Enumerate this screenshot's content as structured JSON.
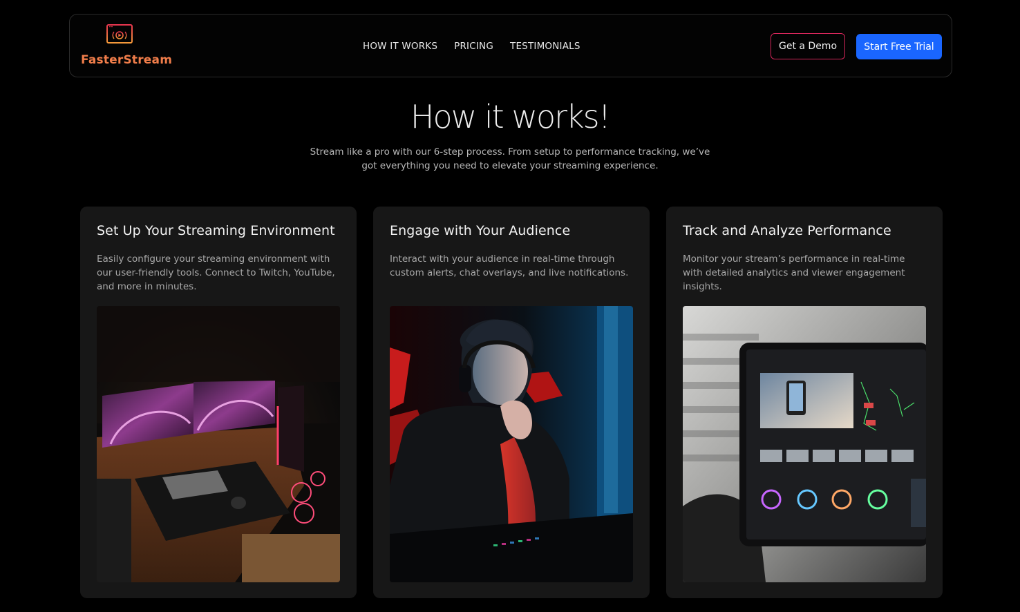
{
  "brand": {
    "name": "FasterStream",
    "logo_icon": "monitor-stream-icon",
    "accent": "#f07d4a"
  },
  "nav": {
    "links": [
      "HOW IT WORKS",
      "PRICING",
      "TESTIMONIALS"
    ],
    "demo_label": "Get a Demo",
    "trial_label": "Start Free Trial",
    "demo_border_color": "#d6265a",
    "trial_color": "#1a66ff"
  },
  "hero": {
    "title": "How it works!",
    "subtitle": "Stream like a pro with our 6-step process. From setup to performance tracking, we’ve got everything you need to elevate your streaming experience."
  },
  "cards": [
    {
      "title": "Set Up Your Streaming Environment",
      "text": "Easily configure your streaming environment with our user-friendly tools. Connect to Twitch, YouTube, and more in minutes.",
      "image": "gaming-desk-setup-photo"
    },
    {
      "title": "Engage with Your Audience",
      "text": "Interact with your audience in real-time through custom alerts, chat overlays, and live notifications.",
      "image": "streamer-with-headphones-photo"
    },
    {
      "title": "Track and Analyze Performance",
      "text": "Monitor your stream’s performance in real-time with detailed analytics and viewer engagement insights.",
      "image": "tablet-analytics-app-photo"
    }
  ]
}
